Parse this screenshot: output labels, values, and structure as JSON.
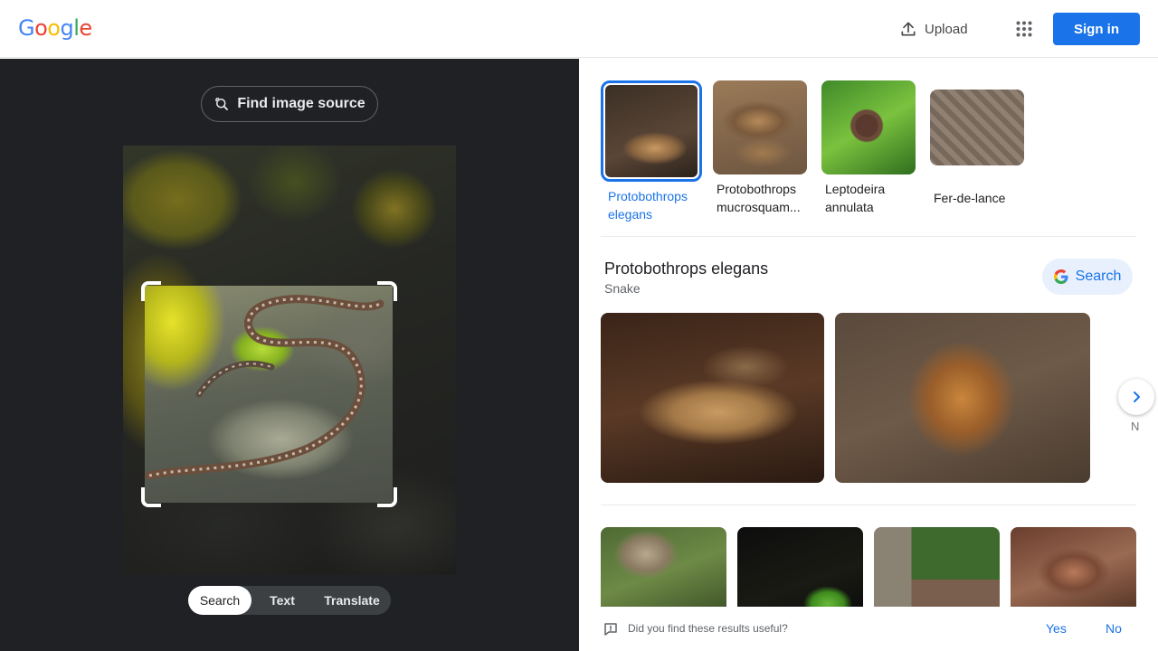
{
  "header": {
    "logo_letters": [
      "G",
      "o",
      "o",
      "g",
      "l",
      "e"
    ],
    "logo_colors": [
      "#4285F4",
      "#EA4335",
      "#FBBC05",
      "#4285F4",
      "#34A853",
      "#EA4335"
    ],
    "upload_label": "Upload",
    "signin_label": "Sign in"
  },
  "left": {
    "find_source_label": "Find image source",
    "modes": [
      "Search",
      "Text",
      "Translate"
    ],
    "active_mode": "Search"
  },
  "matches": [
    {
      "label": "Protobothrops elegans",
      "selected": true
    },
    {
      "label": "Protobothrops mucrosquam...",
      "selected": false
    },
    {
      "label": "Leptodeira annulata",
      "selected": false
    },
    {
      "label": "Fer-de-lance",
      "selected": false
    }
  ],
  "entity": {
    "title": "Protobothrops elegans",
    "subtitle": "Snake",
    "search_label": "Search"
  },
  "peek_text": "N",
  "feedback": {
    "question": "Did you find these results useful?",
    "yes": "Yes",
    "no": "No"
  },
  "colors": {
    "accent": "#1a73e8",
    "left_bg": "#202124"
  }
}
